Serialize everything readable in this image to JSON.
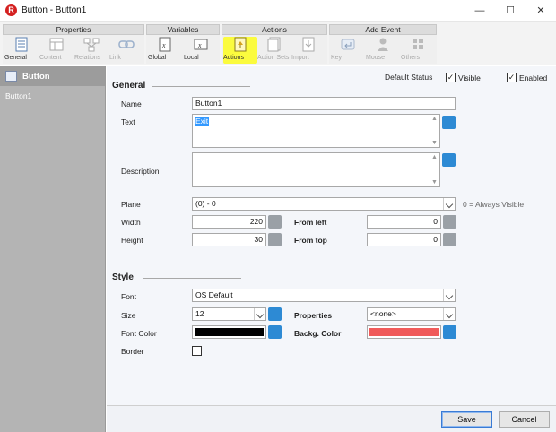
{
  "window": {
    "title": "Button - Button1",
    "minimize": "—",
    "maximize": "☐",
    "close": "✕"
  },
  "ribbon": {
    "groups": {
      "properties": "Properties",
      "variables": "Variables",
      "actions": "Actions",
      "add_event": "Add Event"
    },
    "buttons": {
      "general": "General",
      "content": "Content",
      "relations": "Relations",
      "link": "Link",
      "global": "Global",
      "local": "Local",
      "actions": "Actions",
      "action_sets": "Action Sets",
      "import": "Import",
      "key": "Key",
      "mouse": "Mouse",
      "others": "Others"
    }
  },
  "left_panel": {
    "title": "Button",
    "item": "Button1"
  },
  "general": {
    "section_title": "General",
    "default_status_label": "Default Status",
    "visible_label": "Visible",
    "visible_checked": true,
    "enabled_label": "Enabled",
    "enabled_checked": true,
    "name_label": "Name",
    "name_value": "Button1",
    "text_label": "Text",
    "text_value": "Exit",
    "description_label": "Description",
    "description_value": "",
    "plane_label": "Plane",
    "plane_value": "(0)  - 0",
    "plane_hint": "0 = Always Visible",
    "width_label": "Width",
    "width_value": "220",
    "height_label": "Height",
    "height_value": "30",
    "from_left_label": "From left",
    "from_left_value": "0",
    "from_top_label": "From top",
    "from_top_value": "0"
  },
  "style": {
    "section_title": "Style",
    "font_label": "Font",
    "font_value": "OS Default",
    "size_label": "Size",
    "size_value": "12",
    "properties_label": "Properties",
    "properties_value": "<none>",
    "font_color_label": "Font Color",
    "font_color": "#000000",
    "backg_color_label": "Backg. Color",
    "backg_color": "#f05a5a",
    "border_label": "Border",
    "border_checked": false
  },
  "footer": {
    "save": "Save",
    "cancel": "Cancel"
  },
  "colors": {
    "highlight": "#fbfb3e",
    "accent_blue": "#2d8ad4"
  }
}
